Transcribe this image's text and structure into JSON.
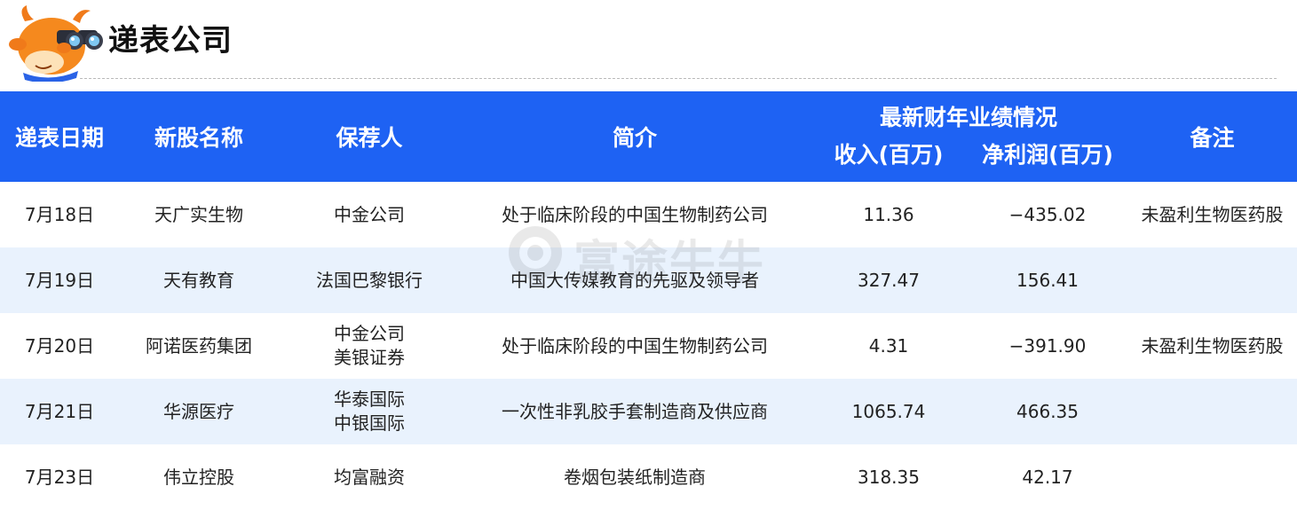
{
  "header": {
    "title": "递表公司",
    "brand_color": "#1e62f3"
  },
  "watermark": {
    "text": "富途牛牛"
  },
  "table": {
    "columns": {
      "date": "递表日期",
      "name": "新股名称",
      "sponsor": "保荐人",
      "intro": "简介",
      "perf_group": "最新财年业绩情况",
      "revenue": "收入(百万)",
      "net_profit": "净利润(百万)",
      "remark": "备注"
    },
    "rows": [
      {
        "date": "7月18日",
        "name": "天广实生物",
        "sponsor": [
          "中金公司"
        ],
        "intro": "处于临床阶段的中国生物制药公司",
        "revenue": "11.36",
        "net_profit": "−435.02",
        "remark": "未盈利生物医药股"
      },
      {
        "date": "7月19日",
        "name": "天有教育",
        "sponsor": [
          "法国巴黎银行"
        ],
        "intro": "中国大传媒教育的先驱及领导者",
        "revenue": "327.47",
        "net_profit": "156.41",
        "remark": ""
      },
      {
        "date": "7月20日",
        "name": "阿诺医药集团",
        "sponsor": [
          "中金公司",
          "美银证券"
        ],
        "intro": "处于临床阶段的中国生物制药公司",
        "revenue": "4.31",
        "net_profit": "−391.90",
        "remark": "未盈利生物医药股"
      },
      {
        "date": "7月21日",
        "name": "华源医疗",
        "sponsor": [
          "华泰国际",
          "中银国际"
        ],
        "intro": "一次性非乳胶手套制造商及供应商",
        "revenue": "1065.74",
        "net_profit": "466.35",
        "remark": ""
      },
      {
        "date": "7月23日",
        "name": "伟立控股",
        "sponsor": [
          "均富融资"
        ],
        "intro": "卷烟包装纸制造商",
        "revenue": "318.35",
        "net_profit": "42.17",
        "remark": ""
      }
    ]
  }
}
